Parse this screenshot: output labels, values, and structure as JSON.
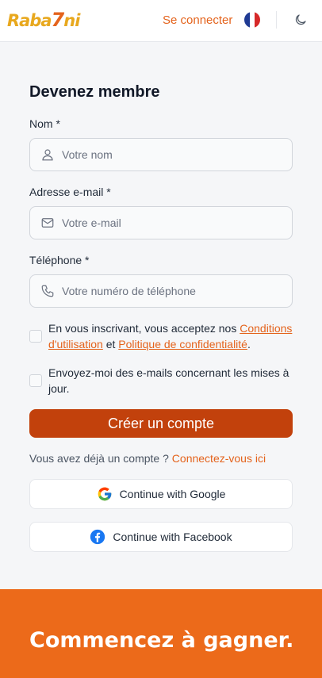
{
  "header": {
    "logo_text_main": "Raba",
    "logo_text_seven": "7",
    "logo_text_end": "ni",
    "login_label": "Se connecter",
    "language_flag": "fr-flag-icon",
    "theme_toggle_icon": "moon-icon"
  },
  "form": {
    "title": "Devenez membre",
    "name": {
      "label": "Nom *",
      "placeholder": "Votre nom",
      "icon": "user-icon"
    },
    "email": {
      "label": "Adresse e-mail *",
      "placeholder": "Votre e-mail",
      "icon": "envelope-icon"
    },
    "phone": {
      "label": "Téléphone *",
      "placeholder": "Votre numéro de téléphone",
      "icon": "phone-icon"
    },
    "terms": {
      "text_before": "En vous inscrivant, vous acceptez nos ",
      "link_conditions": "Conditions d'utilisation",
      "text_and": " et ",
      "link_privacy": "Politique de confidentialité",
      "text_after": "."
    },
    "newsletter_text": "Envoyez-moi des e-mails concernant les mises à jour.",
    "submit_label": "Créer un compte",
    "have_account_text": "Vous avez déjà un compte ? ",
    "have_account_link": "Connectez-vous ici",
    "google_label": "Continue with Google",
    "facebook_label": "Continue with Facebook"
  },
  "promo": {
    "title": "Commencez à gagner."
  },
  "colors": {
    "accent": "#e4631c",
    "button": "#c2410c",
    "promo_bg": "#ec6a1a",
    "logo_yellow": "#e8a81e"
  }
}
